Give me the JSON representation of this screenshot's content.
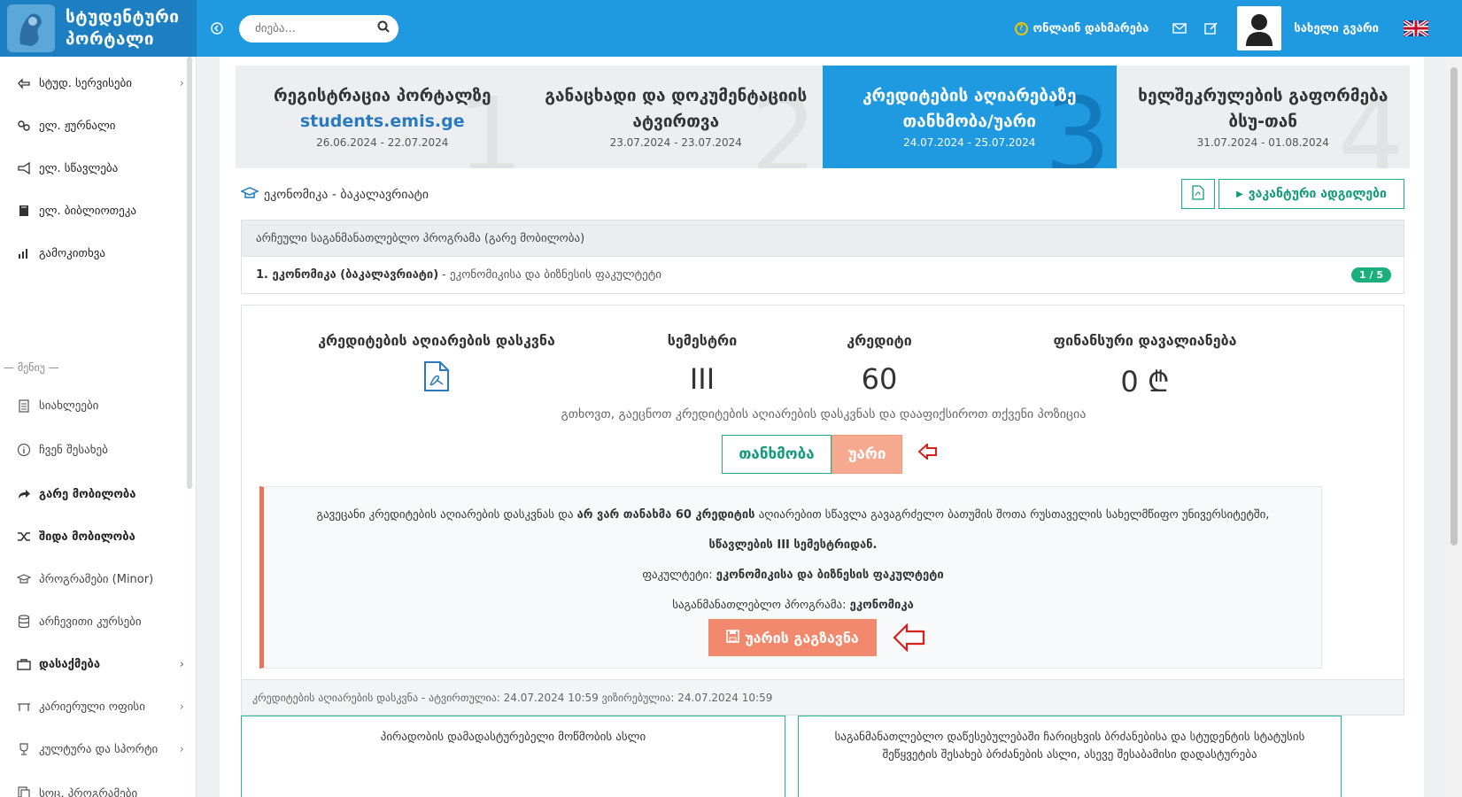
{
  "header": {
    "logo_line1": "სტუდენტური",
    "logo_line2": "პორტალი",
    "search_placeholder": "ძიება...",
    "help_label": "ონლაინ დახმარება",
    "user_name": "სახელი გვარი",
    "accent_color": "#1f9ae0"
  },
  "sidebar": {
    "items": [
      {
        "label": "სტუდ. სერვისები",
        "icon": "hand-pointer-icon"
      },
      {
        "label": "ელ. ჟურნალი",
        "icon": "link-icon"
      },
      {
        "label": "ელ. სწავლება",
        "icon": "bullhorn-icon"
      },
      {
        "label": "ელ. ბიბლიოთეკა",
        "icon": "book-icon"
      },
      {
        "label": "გამოკითხვა",
        "icon": "bar-chart-icon"
      },
      {
        "label": "სიახლეები",
        "icon": "clipboard-icon"
      },
      {
        "label": "ჩვენ შესახებ",
        "icon": "info-icon"
      },
      {
        "label": "გარე მობილობა",
        "icon": "share-icon"
      },
      {
        "label": "შიდა მობილობა",
        "icon": "shuffle-icon"
      },
      {
        "label": "პროგრამები (Minor)",
        "icon": "graduation-cap-icon"
      },
      {
        "label": "არჩევითი კურსები",
        "icon": "database-icon"
      },
      {
        "label": "დასაქმება",
        "icon": "briefcase-icon"
      },
      {
        "label": "კარიერული ოფისი",
        "icon": "desk-icon"
      },
      {
        "label": "კულტურა და სპორტი",
        "icon": "trophy-icon"
      },
      {
        "label": "სოც. პროგრამები",
        "icon": "copy-icon"
      }
    ],
    "menu_divider": "— მენიუ —"
  },
  "steps": [
    {
      "num": "1",
      "title": "რეგისტრაცია პორტალზე",
      "link": "students.emis.ge",
      "date": "26.06.2024 - 22.07.2024"
    },
    {
      "num": "2",
      "title": "განაცხადი და დოკუმენტაციის ატვირთვა",
      "date": "23.07.2024 - 23.07.2024"
    },
    {
      "num": "3",
      "title": "კრედიტების აღიარებაზე თანხმობა/უარი",
      "date": "24.07.2024 - 25.07.2024"
    },
    {
      "num": "4",
      "title": "ხელშეკრულების გაფორმება ბსუ-თან",
      "date": "31.07.2024 - 01.08.2024"
    }
  ],
  "program": {
    "title": "ეკონომიკა - ბაკალავრიატი",
    "vacancy_button": "ვაკანტური ადგილები",
    "selected_header": "არჩეული საგანმანათლებლო პროგრამა (გარე მობილობა)",
    "selected_name": "1. ეკონომიკა (ბაკალავრიატი)",
    "selected_faculty": "- ეკონომიკისა და ბიზნესის ფაკულტეტი",
    "badge": "1 / 5"
  },
  "recognition": {
    "label_conclusion": "კრედიტების აღიარების დასკვნა",
    "label_semester": "სემესტრი",
    "label_credit": "კრედიტი",
    "label_debt": "ფინანსური დავალიანება",
    "semester": "III",
    "credit": "60",
    "debt": "0 ₾",
    "instruction": "გთხოვთ, გაეცნოთ კრედიტების აღიარების დასკვნას და დააფიქსიროთ თქვენი პოზიცია",
    "agree": "თანხმობა",
    "refuse": "უარი"
  },
  "notice": {
    "line1_pre": "გავეცანი კრედიტების აღიარების დასკვნას და",
    "line1_bold": "არ ვარ თანახმა 60 კრედიტის",
    "line1_post": "აღიარებით სწავლა გავაგრძელო ბათუმის შოთა რუსთაველის სახელმწიფო უნივერსიტეტში,",
    "line2": "სწავლების III სემესტრიდან.",
    "faculty_label": "ფაკულტეტი:",
    "faculty_value": "ეკონომიკისა და ბიზნესის ფაკულტეტი",
    "program_label": "საგანმანათლებლო პროგრამა:",
    "program_value": "ეკონომიკა",
    "send_button": "უარის გაგზავნა"
  },
  "footer_meta": "კრედიტების აღიარების დასკვნა - ატვირთულია: 24.07.2024 10:59 ვიზირებულია: 24.07.2024 10:59",
  "documents": [
    {
      "title": "პირადობის დამადასტურებელი მოწმობის ასლი"
    },
    {
      "title": "საგანმანათლებლო დაწესებულებაში ჩარიცხვის ბრძანებისა და სტუდენტის სტატუსის შეწყვეტის შესახებ ბრძანების ასლი, ასევე შესაბამისი დადასტურება"
    }
  ]
}
